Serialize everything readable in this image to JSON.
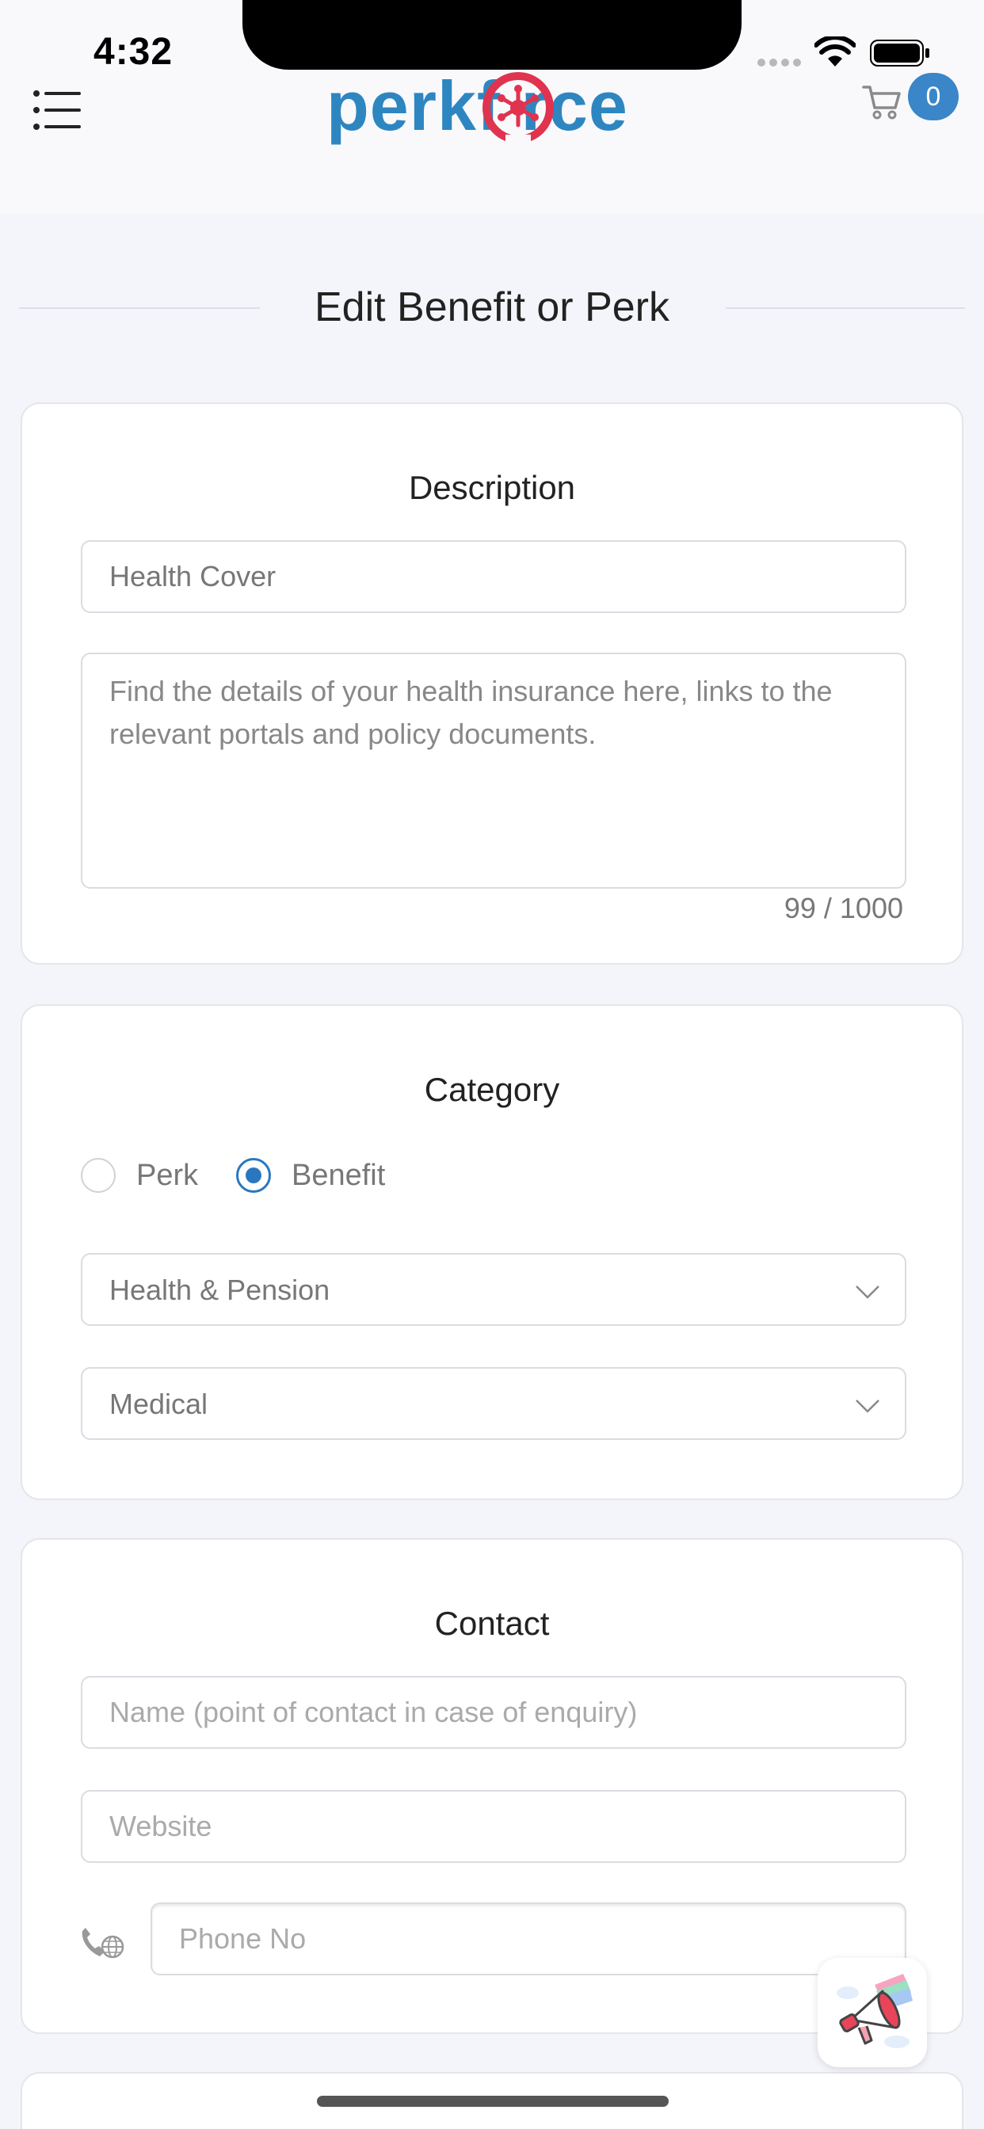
{
  "status_bar": {
    "time": "4:32"
  },
  "header": {
    "logo_text": "perkf   rce",
    "cart_count": "0",
    "icons": {
      "menu": "menu-list-icon",
      "cart": "cart-icon",
      "logo": "perkforce-star-logo"
    }
  },
  "page": {
    "title": "Edit Benefit or Perk"
  },
  "description": {
    "title": "Description",
    "name_value": "Health Cover",
    "details_value": "Find the details of your health insurance here, links to the relevant portals and policy documents.",
    "counter": "99 / 1000"
  },
  "category": {
    "title": "Category",
    "options": [
      {
        "label": "Perk",
        "checked": false
      },
      {
        "label": "Benefit",
        "checked": true
      }
    ],
    "group_value": "Health & Pension",
    "type_value": "Medical"
  },
  "contact": {
    "title": "Contact",
    "name_placeholder": "Name (point of contact in case of enquiry)",
    "website_placeholder": "Website",
    "phone_placeholder": "Phone No",
    "phone_icon": "phone-globe-icon"
  },
  "fab": {
    "icon": "megaphone-icon"
  },
  "colors": {
    "accent": "#2a77c0",
    "logo": "#2e86c1",
    "logo_mark": "#e0334f",
    "badge": "#3a86c8"
  }
}
